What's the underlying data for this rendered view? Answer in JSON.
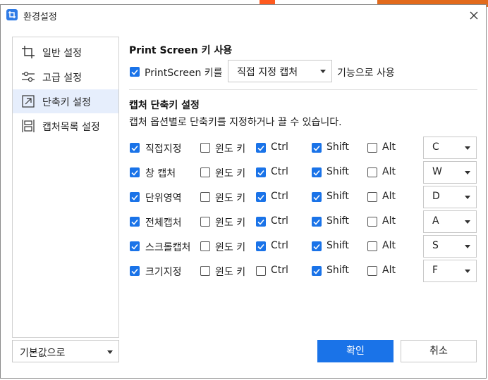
{
  "window": {
    "title": "환경설정"
  },
  "sidebar": {
    "items": [
      {
        "label": "일반 설정",
        "icon": "crop-icon",
        "active": false
      },
      {
        "label": "고급 설정",
        "icon": "sliders-icon",
        "active": false
      },
      {
        "label": "단축키 설정",
        "icon": "shortcut-arrow-icon",
        "active": true
      },
      {
        "label": "캡처목록 설정",
        "icon": "capture-list-icon",
        "active": false
      }
    ]
  },
  "reset": {
    "label": "기본값으로"
  },
  "printscreen": {
    "section_title": "Print Screen 키 사용",
    "checkbox_label": "PrintScreen 키를",
    "checked": true,
    "selected_option": "직접 지정 캡처",
    "suffix": "기능으로 사용"
  },
  "shortcuts": {
    "section_title": "캡처 단축키 설정",
    "description": "캡처 옵션별로 단축키를 지정하거나 끌 수 있습니다.",
    "win_label": "윈도 키",
    "ctrl_label": "Ctrl",
    "shift_label": "Shift",
    "alt_label": "Alt",
    "rows": [
      {
        "name": "직접지정",
        "enabled": true,
        "win": false,
        "ctrl": true,
        "shift": true,
        "alt": false,
        "key": "C"
      },
      {
        "name": "창 캡처",
        "enabled": true,
        "win": false,
        "ctrl": true,
        "shift": true,
        "alt": false,
        "key": "W"
      },
      {
        "name": "단위영역",
        "enabled": true,
        "win": false,
        "ctrl": true,
        "shift": true,
        "alt": false,
        "key": "D"
      },
      {
        "name": "전체캡처",
        "enabled": true,
        "win": false,
        "ctrl": true,
        "shift": true,
        "alt": false,
        "key": "A"
      },
      {
        "name": "스크롤캡처",
        "enabled": true,
        "win": false,
        "ctrl": true,
        "shift": true,
        "alt": false,
        "key": "S"
      },
      {
        "name": "크기지정",
        "enabled": true,
        "win": false,
        "ctrl": false,
        "shift": true,
        "alt": false,
        "key": "F"
      }
    ]
  },
  "buttons": {
    "ok": "확인",
    "cancel": "취소"
  },
  "colors": {
    "accent": "#1a73e8",
    "active_bg": "#e6eefc"
  }
}
